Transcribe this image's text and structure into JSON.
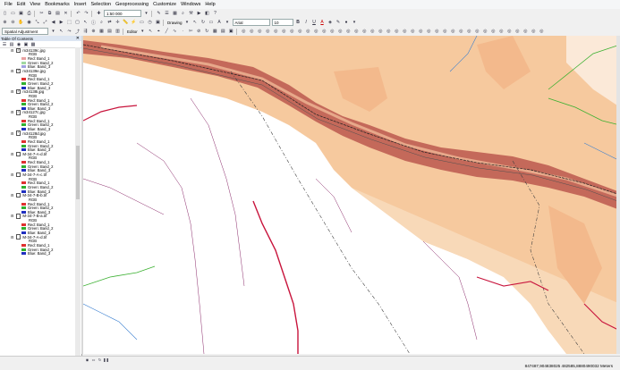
{
  "menu": [
    "File",
    "Edit",
    "View",
    "Bookmarks",
    "Insert",
    "Selection",
    "Geoprocessing",
    "Customize",
    "Windows",
    "Help"
  ],
  "toolbar1": {
    "scale": "1:50 000"
  },
  "toolbar2": {
    "drawing_label": "Drawing",
    "font_name": "Arial",
    "font_size": "10",
    "bold": "B",
    "italic": "I",
    "underline": "U",
    "text_color_glyph": "A",
    "text_tool_glyph": "A"
  },
  "toolbar3": {
    "spatial_adjustment_label": "Spatial Adjustment",
    "editor_label": "Editor"
  },
  "toc": {
    "title": "Table Of Contents",
    "layers": [
      {
        "name": "m34139c.jpg",
        "checked": true
      },
      {
        "name": "m34139e.jpg",
        "checked": true
      },
      {
        "name": "m34138i.jpg",
        "checked": true
      },
      {
        "name": "m34127c.jpg",
        "checked": true
      },
      {
        "name": "m34128d.jpg",
        "checked": true
      },
      {
        "name": "M-34-7-A-d.tif",
        "checked": false
      },
      {
        "name": "M-34-7-A-c.tif",
        "checked": false
      },
      {
        "name": "M-34-7-B-b.tif",
        "checked": false
      },
      {
        "name": "M-34-7-B-a.tif",
        "checked": false
      },
      {
        "name": "M-34-7-A-d.tif",
        "checked": false
      }
    ],
    "rgb_label": "RGB",
    "bands": [
      {
        "label": "Red:   Band_1",
        "color": "#e03030"
      },
      {
        "label": "Green: Band_2",
        "color": "#30b030"
      },
      {
        "label": "Blue:  Band_3",
        "color": "#2030c0"
      }
    ],
    "first_swatch_colors": [
      "#e8a0a0",
      "#a0d8a0",
      "#a0a0e0"
    ]
  },
  "status": {
    "coordinates": "847487,904838025  482585,8880490032 Meters"
  },
  "colors": {
    "terrain_orange": "#f6c99e",
    "valley_dark": "#c4695a",
    "river_red": "#c8143c",
    "stream_blue": "#3a7fd0",
    "stream_green": "#3ab030",
    "boundary": "#404040"
  }
}
